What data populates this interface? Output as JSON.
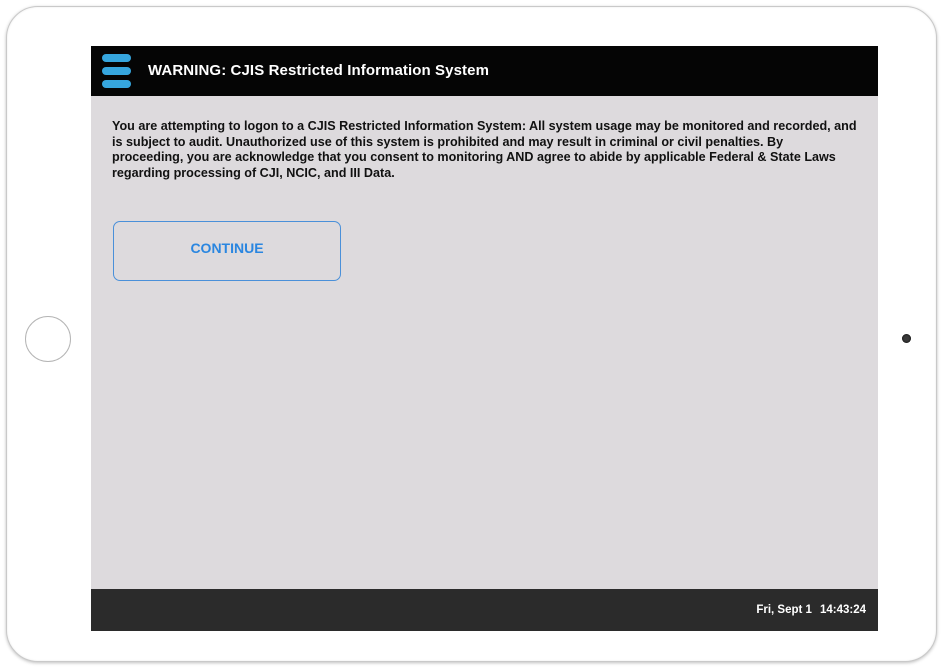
{
  "header": {
    "title": "WARNING: CJIS Restricted Information System",
    "menu_icon": "hamburger-menu-icon",
    "accent_color": "#36a6de",
    "background_color": "#050505"
  },
  "main": {
    "warning_message": "You are attempting to logon to a CJIS Restricted Information System: All system usage may be monitored and recorded, and is subject to audit. Unauthorized use of this system is prohibited and may result in criminal or civil penalties. By proceeding, you are acknowledge that you consent to monitoring AND agree to abide by applicable Federal & State Laws regarding processing of CJI, NCIC, and III Data.",
    "continue_label": "CONTINUE",
    "button_color": "#2a86e0",
    "background_color": "#dddadd"
  },
  "footer": {
    "date": "Fri, Sept 1",
    "time": "14:43:24",
    "background_color": "#2b2b2b"
  }
}
